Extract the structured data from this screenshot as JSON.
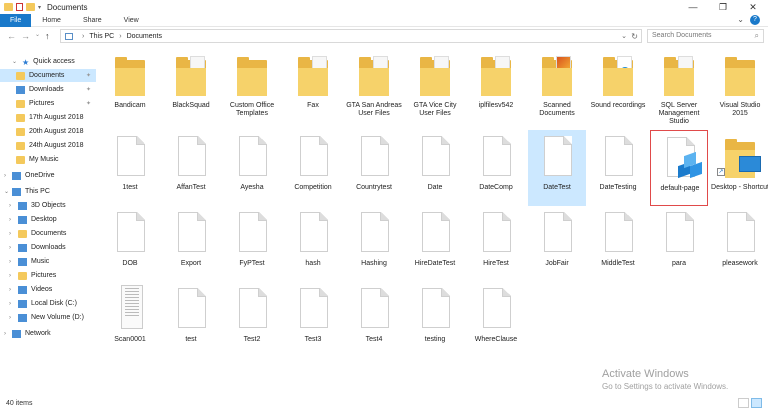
{
  "window": {
    "title": "Documents",
    "controls": [
      "—",
      "❐",
      "✕"
    ]
  },
  "ribbon": {
    "tabs": [
      "File",
      "Home",
      "Share",
      "View"
    ],
    "help": "?"
  },
  "address": {
    "crumbs": [
      "This PC",
      "Documents"
    ],
    "search_placeholder": "Search Documents"
  },
  "sidebar": {
    "items": [
      {
        "label": "Quick access",
        "icon": "star-icon"
      },
      {
        "label": "Documents",
        "icon": "documents-icon"
      },
      {
        "label": "Downloads",
        "icon": "download-icon"
      },
      {
        "label": "Pictures",
        "icon": "pictures-icon"
      },
      {
        "label": "17th August 2018",
        "icon": "folder-icon"
      },
      {
        "label": "20th August 2018",
        "icon": "folder-icon"
      },
      {
        "label": "24th August 2018",
        "icon": "folder-icon"
      },
      {
        "label": "My Music",
        "icon": "folder-icon"
      },
      {
        "label": "OneDrive",
        "icon": "cloud-icon"
      },
      {
        "label": "This PC",
        "icon": "computer-icon"
      },
      {
        "label": "3D Objects",
        "icon": "cube-icon"
      },
      {
        "label": "Desktop",
        "icon": "desktop-icon"
      },
      {
        "label": "Documents",
        "icon": "documents-icon"
      },
      {
        "label": "Downloads",
        "icon": "download-icon"
      },
      {
        "label": "Music",
        "icon": "music-icon"
      },
      {
        "label": "Pictures",
        "icon": "pictures-icon"
      },
      {
        "label": "Videos",
        "icon": "videos-icon"
      },
      {
        "label": "Local Disk (C:)",
        "icon": "disk-icon"
      },
      {
        "label": "New Volume (D:)",
        "icon": "disk-icon"
      },
      {
        "label": "Network",
        "icon": "network-icon"
      }
    ]
  },
  "files": [
    {
      "label": "Bandicam",
      "type": "folder"
    },
    {
      "label": "BlackSquad",
      "type": "folder-paper"
    },
    {
      "label": "Custom Office Templates",
      "type": "folder"
    },
    {
      "label": "Fax",
      "type": "folder-paper"
    },
    {
      "label": "GTA San Andreas User Files",
      "type": "folder-paper"
    },
    {
      "label": "GTA Vice City User Files",
      "type": "folder-paper"
    },
    {
      "label": "iplfilesv542",
      "type": "folder-paper"
    },
    {
      "label": "Scanned Documents",
      "type": "folder-image"
    },
    {
      "label": "Sound recordings",
      "type": "folder-sound"
    },
    {
      "label": "SQL Server Management Studio",
      "type": "folder-paper"
    },
    {
      "label": "Visual Studio 2015",
      "type": "folder"
    },
    {
      "label": "1test",
      "type": "doc"
    },
    {
      "label": "AffanTest",
      "type": "doc"
    },
    {
      "label": "Ayesha",
      "type": "doc"
    },
    {
      "label": "Competition",
      "type": "doc"
    },
    {
      "label": "Countrytest",
      "type": "doc"
    },
    {
      "label": "Date",
      "type": "doc"
    },
    {
      "label": "DateComp",
      "type": "doc"
    },
    {
      "label": "DateTest",
      "type": "doc"
    },
    {
      "label": "DateTesting",
      "type": "doc"
    },
    {
      "label": "default-page",
      "type": "regedit"
    },
    {
      "label": "Desktop - Shortcut",
      "type": "shortcut"
    },
    {
      "label": "DOB",
      "type": "doc"
    },
    {
      "label": "Export",
      "type": "doc"
    },
    {
      "label": "FyPTest",
      "type": "doc"
    },
    {
      "label": "hash",
      "type": "doc"
    },
    {
      "label": "Hashing",
      "type": "doc"
    },
    {
      "label": "HireDateTest",
      "type": "doc"
    },
    {
      "label": "HireTest",
      "type": "doc"
    },
    {
      "label": "JobFair",
      "type": "doc"
    },
    {
      "label": "MiddleTest",
      "type": "doc"
    },
    {
      "label": "para",
      "type": "doc"
    },
    {
      "label": "pleasework",
      "type": "doc"
    },
    {
      "label": "Scan0001",
      "type": "scan"
    },
    {
      "label": "test",
      "type": "doc"
    },
    {
      "label": "Test2",
      "type": "doc"
    },
    {
      "label": "Test3",
      "type": "doc"
    },
    {
      "label": "Test4",
      "type": "doc"
    },
    {
      "label": "testing",
      "type": "doc"
    },
    {
      "label": "WhereClause",
      "type": "doc"
    }
  ],
  "selected_file": "DateTest",
  "highlighted_file": "default-page",
  "status": {
    "count": "40 items"
  },
  "watermark": {
    "line1": "Activate Windows",
    "line2": "Go to Settings to activate Windows."
  },
  "colors": {
    "accent": "#1979ca",
    "selection": "#cce8ff",
    "highlight_border": "#e04a4a"
  }
}
